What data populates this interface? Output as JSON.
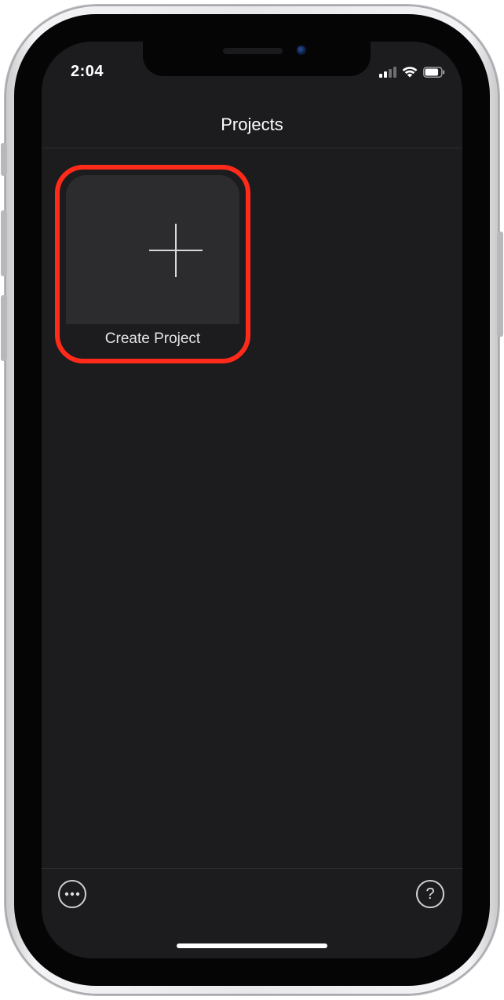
{
  "status_bar": {
    "time": "2:04",
    "signal_icon": "cellular-signal-icon",
    "wifi_icon": "wifi-icon",
    "battery_icon": "battery-icon",
    "signal_bars_active": 2,
    "signal_bars_total": 4,
    "battery_level": 0.85
  },
  "nav": {
    "title": "Projects"
  },
  "projects": {
    "create_tile": {
      "icon": "plus-icon",
      "label": "Create Project"
    }
  },
  "highlight_color": "#ff2a1a",
  "toolbar": {
    "more_icon": "ellipsis-circle-icon",
    "help_icon": "question-circle-icon",
    "help_glyph": "?"
  },
  "colors": {
    "background": "#1c1c1e",
    "tile": "#2c2c2e",
    "text": "#ffffff"
  }
}
